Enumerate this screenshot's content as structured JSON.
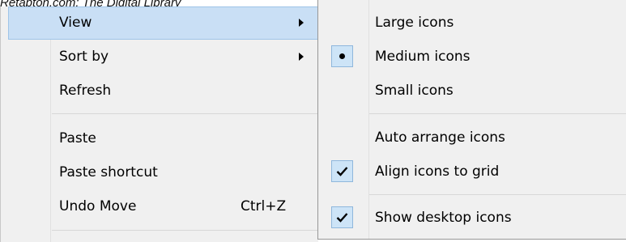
{
  "watermark": "Retabton.com: The Digital Library",
  "context_menu": {
    "items": [
      {
        "label": "View"
      },
      {
        "label": "Sort by"
      },
      {
        "label": "Refresh"
      },
      {
        "label": "Paste"
      },
      {
        "label": "Paste shortcut"
      },
      {
        "label": "Undo Move",
        "shortcut": "Ctrl+Z"
      }
    ]
  },
  "view_submenu": {
    "items": [
      {
        "label": "Large icons",
        "checked": false
      },
      {
        "label": "Medium icons",
        "checked": true,
        "mark": "radio-bullet"
      },
      {
        "label": "Small icons",
        "checked": false
      },
      {
        "label": "Auto arrange icons",
        "checked": false
      },
      {
        "label": "Align icons to grid",
        "checked": true,
        "mark": "checkmark"
      },
      {
        "label": "Show desktop icons",
        "checked": true,
        "mark": "checkmark"
      }
    ]
  },
  "colors": {
    "menu_background": "#f0f0f0",
    "highlight_fill": "#c9dff5",
    "highlight_border": "#9fc4e8",
    "check_box_fill": "#cde4f7"
  }
}
